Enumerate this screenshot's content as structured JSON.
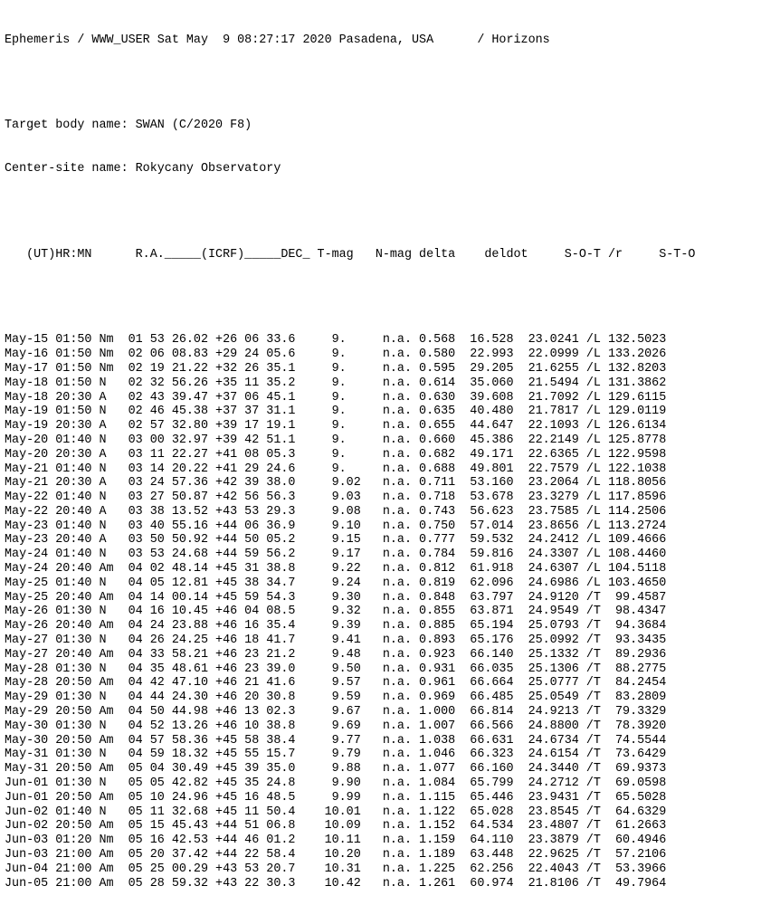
{
  "header": {
    "line1": "Ephemeris / WWW_USER Sat May  9 08:27:17 2020 Pasadena, USA      / Horizons",
    "line2": "Target body name: SWAN (C/2020 F8)",
    "line3": "Center-site name: Rokycany Observatory"
  },
  "columns": "   (UT)HR:MN      R.A._____(ICRF)_____DEC_ T-mag   N-mag delta    deldot     S-O-T /r     S-T-O",
  "rows": [
    "May-15 01:50 Nm  01 53 26.02 +26 06 33.6     9.     n.a. 0.568  16.528  23.0241 /L 132.5023",
    "May-16 01:50 Nm  02 06 08.83 +29 24 05.6     9.     n.a. 0.580  22.993  22.0999 /L 133.2026",
    "May-17 01:50 Nm  02 19 21.22 +32 26 35.1     9.     n.a. 0.595  29.205  21.6255 /L 132.8203",
    "May-18 01:50 N   02 32 56.26 +35 11 35.2     9.     n.a. 0.614  35.060  21.5494 /L 131.3862",
    "May-18 20:30 A   02 43 39.47 +37 06 45.1     9.     n.a. 0.630  39.608  21.7092 /L 129.6115",
    "May-19 01:50 N   02 46 45.38 +37 37 31.1     9.     n.a. 0.635  40.480  21.7817 /L 129.0119",
    "May-19 20:30 A   02 57 32.80 +39 17 19.1     9.     n.a. 0.655  44.647  22.1093 /L 126.6134",
    "May-20 01:40 N   03 00 32.97 +39 42 51.1     9.     n.a. 0.660  45.386  22.2149 /L 125.8778",
    "May-20 20:30 A   03 11 22.27 +41 08 05.3     9.     n.a. 0.682  49.171  22.6365 /L 122.9598",
    "May-21 01:40 N   03 14 20.22 +41 29 24.6     9.     n.a. 0.688  49.801  22.7579 /L 122.1038",
    "May-21 20:30 A   03 24 57.36 +42 39 38.0     9.02   n.a. 0.711  53.160  23.2064 /L 118.8056",
    "May-22 01:40 N   03 27 50.87 +42 56 56.3     9.03   n.a. 0.718  53.678  23.3279 /L 117.8596",
    "May-22 20:40 A   03 38 13.52 +43 53 29.3     9.08   n.a. 0.743  56.623  23.7585 /L 114.2506",
    "May-23 01:40 N   03 40 55.16 +44 06 36.9     9.10   n.a. 0.750  57.014  23.8656 /L 113.2724",
    "May-23 20:40 A   03 50 50.92 +44 50 05.2     9.15   n.a. 0.777  59.532  24.2412 /L 109.4666",
    "May-24 01:40 N   03 53 24.68 +44 59 56.2     9.17   n.a. 0.784  59.816  24.3307 /L 108.4460",
    "May-24 20:40 Am  04 02 48.14 +45 31 38.8     9.22   n.a. 0.812  61.918  24.6307 /L 104.5118",
    "May-25 01:40 N   04 05 12.81 +45 38 34.7     9.24   n.a. 0.819  62.096  24.6986 /L 103.4650",
    "May-25 20:40 Am  04 14 00.14 +45 59 54.3     9.30   n.a. 0.848  63.797  24.9120 /T  99.4587",
    "May-26 01:30 N   04 16 10.45 +46 04 08.5     9.32   n.a. 0.855  63.871  24.9549 /T  98.4347",
    "May-26 20:40 Am  04 24 23.88 +46 16 35.4     9.39   n.a. 0.885  65.194  25.0793 /T  94.3684",
    "May-27 01:30 N   04 26 24.25 +46 18 41.7     9.41   n.a. 0.893  65.176  25.0992 /T  93.3435",
    "May-27 20:40 Am  04 33 58.21 +46 23 21.2     9.48   n.a. 0.923  66.140  25.1332 /T  89.2936",
    "May-28 01:30 N   04 35 48.61 +46 23 39.0     9.50   n.a. 0.931  66.035  25.1306 /T  88.2775",
    "May-28 20:50 Am  04 42 47.10 +46 21 41.6     9.57   n.a. 0.961  66.664  25.0777 /T  84.2454",
    "May-29 01:30 N   04 44 24.30 +46 20 30.8     9.59   n.a. 0.969  66.485  25.0549 /T  83.2809",
    "May-29 20:50 Am  04 50 44.98 +46 13 02.3     9.67   n.a. 1.000  66.814  24.9213 /T  79.3329",
    "May-30 01:30 N   04 52 13.26 +46 10 38.8     9.69   n.a. 1.007  66.566  24.8800 /T  78.3920",
    "May-30 20:50 Am  04 57 58.36 +45 58 38.4     9.77   n.a. 1.038  66.631  24.6734 /T  74.5544",
    "May-31 01:30 N   04 59 18.32 +45 55 15.7     9.79   n.a. 1.046  66.323  24.6154 /T  73.6429",
    "May-31 20:50 Am  05 04 30.49 +45 39 35.0     9.88   n.a. 1.077  66.160  24.3440 /T  69.9373",
    "Jun-01 01:30 N   05 05 42.82 +45 35 24.8     9.90   n.a. 1.084  65.799  24.2712 /T  69.0598",
    "Jun-01 20:50 Am  05 10 24.96 +45 16 48.5     9.99   n.a. 1.115  65.446  23.9431 /T  65.5028",
    "Jun-02 01:40 N   05 11 32.68 +45 11 50.4    10.01   n.a. 1.122  65.028  23.8545 /T  64.6329",
    "Jun-02 20:50 Am  05 15 45.43 +44 51 06.8    10.09   n.a. 1.152  64.534  23.4807 /T  61.2663",
    "Jun-03 01:20 Nm  05 16 42.53 +44 46 01.2    10.11   n.a. 1.159  64.110  23.3879 /T  60.4946",
    "Jun-03 21:00 Am  05 20 37.42 +44 22 58.4    10.20   n.a. 1.189  63.448  22.9625 /T  57.2106",
    "Jun-04 21:00 Am  05 25 00.29 +43 53 20.7    10.31   n.a. 1.225  62.256  22.4043 /T  53.3966",
    "Jun-05 21:00 Am  05 28 59.32 +43 22 30.3    10.42   n.a. 1.261  60.974  21.8106 /T  49.7964"
  ]
}
